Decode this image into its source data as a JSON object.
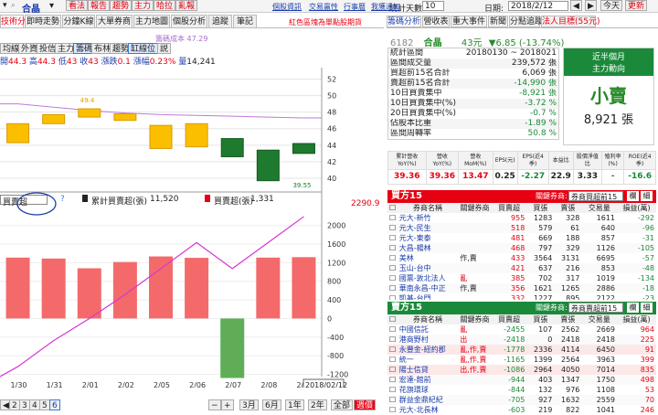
{
  "toolbar": {
    "stock_name": "合晶",
    "buttons": [
      "看法",
      "報告",
      "趨勢",
      "主力",
      "哈拉",
      "亂報"
    ],
    "links": [
      "個股資訊",
      "交易贏性",
      "行事曆",
      "我獲通知"
    ],
    "period_label": "統計天數:",
    "period_value": "10",
    "date_label": "日期:",
    "date_value": "2018/2/12",
    "today_btn": "今天",
    "refresh_btn": "更新"
  },
  "left_tabs": [
    "技術分析",
    "即時走勢",
    "分鐘K線",
    "大單券商",
    "主力地圖",
    "個股分析",
    "追蹤",
    "筆記"
  ],
  "left_notice": "紅色區塊為單點股期貨",
  "indicator_buttons": [
    "均線",
    "外資",
    "投信",
    "主力",
    "籌碼",
    "布林",
    "趨勢",
    "缸線位",
    "説"
  ],
  "legend": {
    "cost_label": "籌碼成本 47.29"
  },
  "ohlc": {
    "open_label": "開",
    "open": "44.3",
    "high_label": "高",
    "high": "44.3",
    "low_label": "低",
    "low": "43",
    "close_label": "收",
    "close": "43",
    "change_label": "漲跌",
    "change": "0.1",
    "pct_label": "漲幅",
    "pct": "0.23%",
    "vol_label": "量",
    "vol": "14,241"
  },
  "price_axis": [
    "52",
    "50",
    "48",
    "46",
    "44",
    "42",
    "40"
  ],
  "cand_labels": {
    "high": "49.4",
    "low": "39.55"
  },
  "vol_panel": {
    "dropdown": "買賣超",
    "q": "?",
    "cum_label": "累計買賣超(張)",
    "cum_value": "11,520",
    "day_label": "買賣超(張)",
    "day_value": "1,331",
    "right_value": "2290.9"
  },
  "vol_axis": [
    "2000",
    "1600",
    "1200",
    "800",
    "400",
    "0",
    "-400",
    "-800",
    "-1200"
  ],
  "x_labels": [
    "1/30",
    "1/31",
    "2/01",
    "2/02",
    "2/05",
    "2/06",
    "2/07",
    "2/08",
    "2/09"
  ],
  "x_year": "2018",
  "x_current": "2018/02/12",
  "bottom_nav": {
    "pages": [
      "2",
      "3",
      "4",
      "5",
      "6"
    ],
    "ranges": [
      "3月",
      "6月",
      "1年",
      "2年",
      "全部",
      "週價"
    ]
  },
  "right_tabs": [
    "籌碼分析",
    "營收表",
    "重大事件",
    "新聞",
    "分點追蹤",
    "法人目標(55元)"
  ],
  "quote": {
    "code": "6182",
    "name": "合晶",
    "price": "43元",
    "change": "▼6.85 (-13.74%)"
  },
  "stats": [
    {
      "k": "統計區間",
      "v": "20180130 ~ 2018021"
    },
    {
      "k": "區間成交量",
      "v": "239,572 張"
    },
    {
      "k": "買超前15名合計",
      "v": "6,069 張"
    },
    {
      "k": "賣超前15名合計",
      "v": "-14,990 張"
    },
    {
      "k": "10日買賣集中",
      "v": "-8,921 張"
    },
    {
      "k": "10日買賣集中(%)",
      "v": "-3.72 %"
    },
    {
      "k": "20日買賣集中(%)",
      "v": "-0.7 %"
    },
    {
      "k": "佔股本比重",
      "v": "-1.89 %"
    },
    {
      "k": "區間周轉率",
      "v": "50.8 %"
    }
  ],
  "trend": {
    "title": "近半個月",
    "subtitle": "主力動向",
    "big": "小賣",
    "amount": "8,921 張"
  },
  "fin_heads": [
    "累計營收YoY(%)",
    "營收YoY(%)",
    "營收MoM(%)",
    "EPS(元)",
    "EPS(近4季)",
    "本益比",
    "股價淨值比",
    "殖利率(%)",
    "ROE(近4季)"
  ],
  "fin_vals": [
    "39.36",
    "39.36",
    "13.47",
    "0.25",
    "-2.27",
    "22.9",
    "3.33",
    "-",
    "-16.6"
  ],
  "buy_panel": {
    "title": "買方15",
    "label": "關鍵券商:",
    "select": "券商買超前15",
    "b1": "欄",
    "b2": "細"
  },
  "sell_panel": {
    "title": "賣方15",
    "label": "關鍵券商:",
    "select": "券商賣超前15",
    "b1": "欄",
    "b2": "細"
  },
  "broker_cols": [
    "券商名稱",
    "關鍵券商",
    "買賣超",
    "買張",
    "賣張",
    "交易量",
    "損益(萬)"
  ],
  "buy_rows": [
    [
      "元大-新竹",
      "",
      "955",
      "1283",
      "328",
      "1611",
      "-292"
    ],
    [
      "元大-民生",
      "",
      "518",
      "579",
      "61",
      "640",
      "-96"
    ],
    [
      "元大-東泰",
      "",
      "481",
      "669",
      "188",
      "857",
      "-31"
    ],
    [
      "大昌-楊林",
      "",
      "468",
      "797",
      "329",
      "1126",
      "-105"
    ],
    [
      "美林",
      "作,賣",
      "433",
      "3564",
      "3131",
      "6695",
      "-57"
    ],
    [
      "玉山-台中",
      "",
      "421",
      "637",
      "216",
      "853",
      "-48"
    ],
    [
      "國票-敦北法人",
      "亂",
      "385",
      "702",
      "317",
      "1019",
      "-134"
    ],
    [
      "華南永昌-中正",
      "作,賣",
      "356",
      "1621",
      "1265",
      "2886",
      "-18"
    ],
    [
      "凱基-台門",
      "",
      "332",
      "1227",
      "895",
      "2122",
      "-23"
    ]
  ],
  "sell_rows": [
    [
      "中國信託",
      "亂",
      "-2455",
      "107",
      "2562",
      "2669",
      "964"
    ],
    [
      "港商野村",
      "出",
      "-2418",
      "0",
      "2418",
      "2418",
      "225"
    ],
    [
      "永豐金-紐約郡",
      "亂,作,賣",
      "-1778",
      "2336",
      "4114",
      "6450",
      "91"
    ],
    [
      "統一",
      "亂,作,賣",
      "-1165",
      "1399",
      "2564",
      "3963",
      "399"
    ],
    [
      "陽士信貸",
      "出,作,賣",
      "-1086",
      "2964",
      "4050",
      "7014",
      "835"
    ],
    [
      "宏達-館前",
      "",
      "-944",
      "403",
      "1347",
      "1750",
      "498"
    ],
    [
      "花旗環球",
      "",
      "-844",
      "132",
      "976",
      "1108",
      "53"
    ],
    [
      "群益金鼎紀紀",
      "",
      "-705",
      "927",
      "1632",
      "2559",
      "70"
    ],
    [
      "元大-北長林",
      "",
      "-603",
      "219",
      "822",
      "1041",
      "246"
    ]
  ],
  "chart_data": {
    "type": "candlestick+bar+line",
    "price": {
      "ylim": [
        39,
        52.5
      ],
      "candles": [
        {
          "x": "1/30",
          "o": 46.6,
          "c": 44.3,
          "color": "red"
        },
        {
          "x": "1/31",
          "o": 47.7,
          "c": 46.6,
          "color": "red"
        },
        {
          "x": "2/01",
          "o": 48.4,
          "c": 47.4,
          "color": "red"
        },
        {
          "x": "2/02",
          "o": 47.8,
          "c": 47.0,
          "color": "red"
        },
        {
          "x": "2/05",
          "o": 46.4,
          "c": 43.6,
          "color": "red"
        },
        {
          "x": "2/06",
          "o": 46.6,
          "c": 43.8,
          "color": "red"
        },
        {
          "x": "2/07",
          "o": 44.8,
          "c": 42.6,
          "color": "green"
        },
        {
          "x": "2/08",
          "o": 43.4,
          "c": 39.7,
          "color": "green"
        },
        {
          "x": "2/09",
          "o": 44.2,
          "c": 43.0,
          "color": "green"
        }
      ],
      "cost_line": [
        49.0,
        48.6,
        48.2,
        47.9,
        47.7,
        47.6,
        47.5,
        47.4,
        47.3
      ],
      "cost_value": "47.29"
    },
    "volume": {
      "ylim": [
        -1250,
        2250
      ],
      "bars": [
        1310,
        1290,
        1080,
        1215,
        1335,
        1305,
        -1280,
        1310,
        1320
      ],
      "cum_line": [
        -2500,
        -1200,
        -100,
        1100,
        2400,
        3700,
        2400,
        3700,
        5000
      ]
    }
  }
}
